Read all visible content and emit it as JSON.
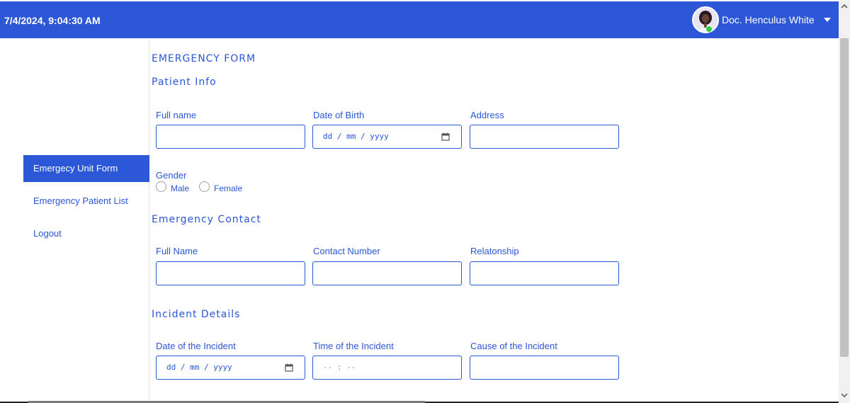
{
  "header": {
    "datetime": "7/4/2024, 9:04:30 AM",
    "user_name": "Doc. Henculus White",
    "brand_color": "#2c57d6",
    "status_color": "#2ecc40"
  },
  "sidebar": {
    "items": [
      {
        "label": "Emergecy Unit Form",
        "active": true
      },
      {
        "label": "Emergency Patient List",
        "active": false
      },
      {
        "label": "Logout",
        "active": false
      }
    ]
  },
  "form": {
    "title": "EMERGENCY FORM",
    "patient_info": {
      "heading": "Patient Info",
      "full_name_label": "Full name",
      "dob_label": "Date of Birth",
      "dob_placeholder": "dd / mm / yyyy",
      "address_label": "Address",
      "gender_label": "Gender",
      "gender_options": [
        "Male",
        "Female"
      ]
    },
    "emergency_contact": {
      "heading": "Emergency Contact",
      "full_name_label": "Full Name",
      "contact_number_label": "Contact Number",
      "relationship_label": "Relatonship"
    },
    "incident_details": {
      "heading": "Incident Details",
      "date_label": "Date of the Incident",
      "date_placeholder": "dd / mm / yyyy",
      "time_label": "Time of the Incident",
      "time_placeholder": "-- : --",
      "cause_label": "Cause of the Incident"
    }
  }
}
